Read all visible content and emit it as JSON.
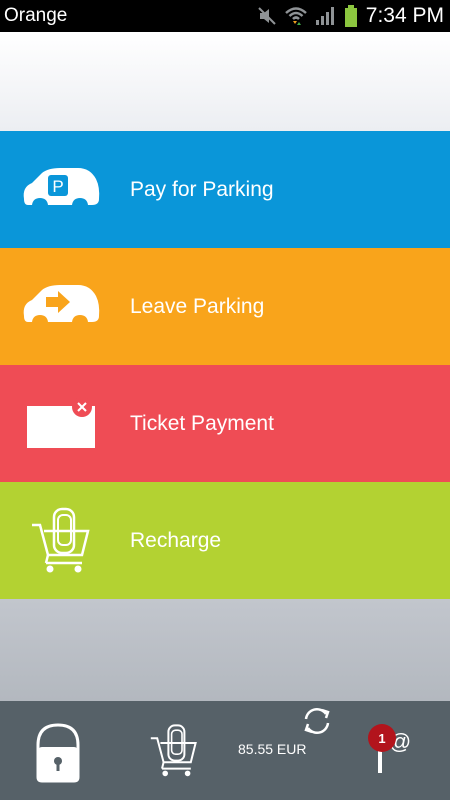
{
  "status_bar": {
    "carrier": "Orange",
    "time": "7:34 PM",
    "icons": [
      "mute-icon",
      "wifi-icon",
      "signal-icon",
      "battery-icon"
    ]
  },
  "menu": {
    "items": [
      {
        "label": "Pay for Parking",
        "icon": "car-parking-icon",
        "color": "#0a96d9"
      },
      {
        "label": "Leave Parking",
        "icon": "car-exit-icon",
        "color": "#f9a41b"
      },
      {
        "label": "Ticket Payment",
        "icon": "ticket-icon",
        "color": "#ef4c55"
      },
      {
        "label": "Recharge",
        "icon": "cart-icon",
        "color": "#b3d232"
      }
    ]
  },
  "bottom_bar": {
    "balance": "85.55 EUR",
    "notification_count": "1",
    "icons": [
      "lock-icon",
      "cart-icon",
      "sync-icon",
      "pin-icon",
      "at-icon"
    ]
  }
}
